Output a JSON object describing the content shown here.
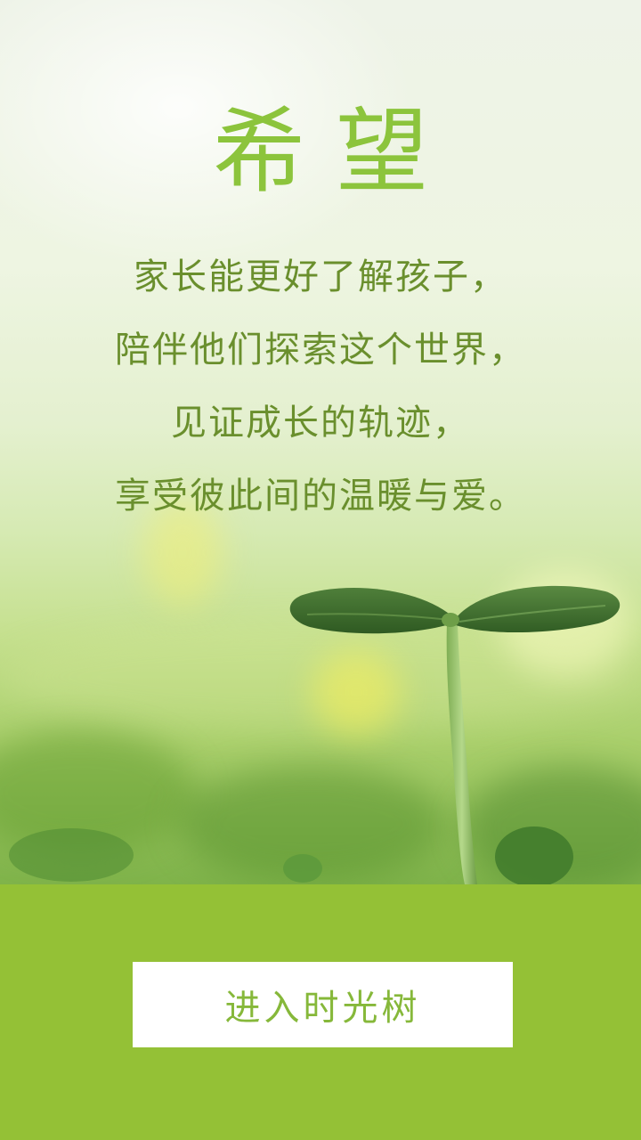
{
  "hero": {
    "title": "希望",
    "lines": [
      "家长能更好了解孩子，",
      "陪伴他们探索这个世界，",
      "见证成长的轨迹，",
      "享受彼此间的温暖与爱。"
    ]
  },
  "footer": {
    "enter_label": "进入时光树"
  },
  "colors": {
    "title": "#8cc43c",
    "body_text": "#6a8f2d",
    "footer_bg": "#94c136",
    "button_bg": "#ffffff",
    "button_text": "#86b83a"
  }
}
